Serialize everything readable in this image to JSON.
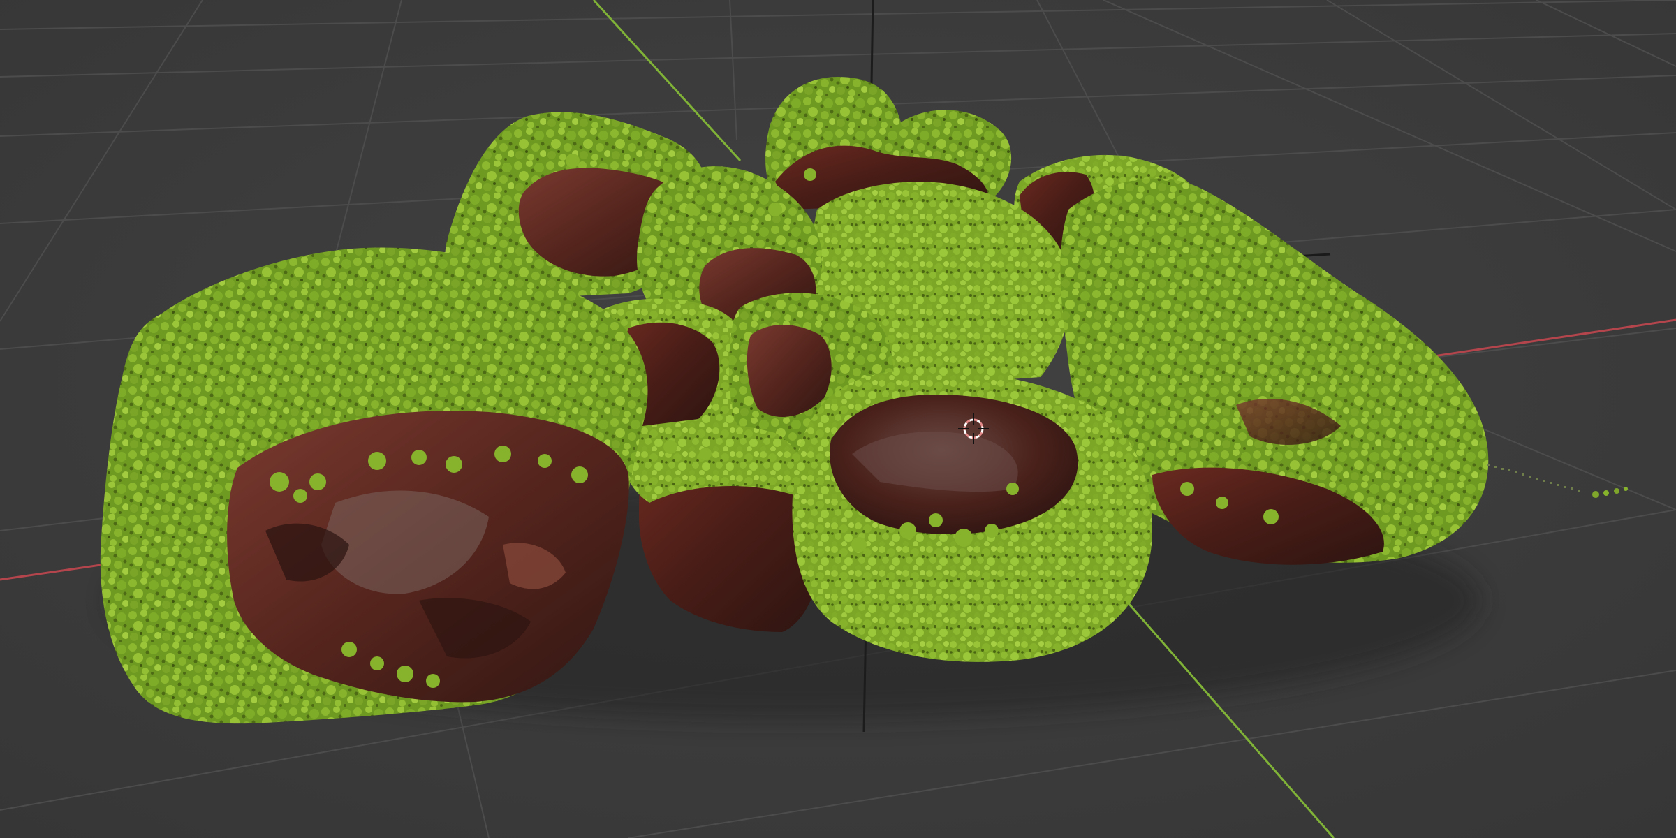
{
  "viewport": {
    "background": "#3a3a3a",
    "grid_color": "#4c4c4c",
    "x_axis_color": "#b5454d",
    "y_axis_color": "#7fb237",
    "z_axis_color": "#1c1c1c"
  },
  "scene": {
    "moss_color": "#7faa2a",
    "rock_color": "#4b2019",
    "cursor_color": "#e58b8b"
  }
}
